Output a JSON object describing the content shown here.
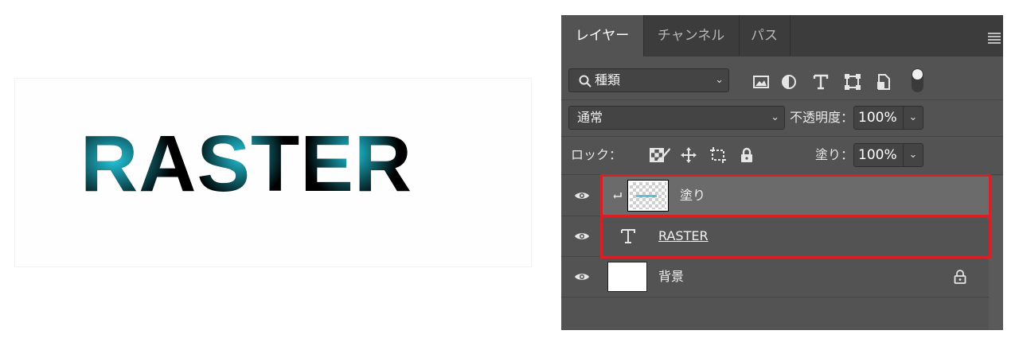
{
  "artwork": {
    "text": "RASTER",
    "glow_color": "#22c8dc"
  },
  "panel": {
    "tabs": [
      "レイヤー",
      "チャンネル",
      "パス"
    ],
    "filter": {
      "kind_label": "種類",
      "icons": [
        "image-filter-icon",
        "adjustment-filter-icon",
        "type-filter-icon",
        "shape-filter-icon",
        "smart-object-filter-icon",
        "filter-toggle-icon"
      ]
    },
    "blend_mode": "通常",
    "opacity_label": "不透明度：",
    "opacity_value": "100%",
    "lock_label": "ロック：",
    "lock_icons": [
      "lock-transparent-icon",
      "lock-paint-icon",
      "lock-position-icon",
      "lock-artboard-icon",
      "lock-all-icon"
    ],
    "fill_label": "塗り：",
    "fill_value": "100%",
    "layers": [
      {
        "name": "塗り",
        "type": "raster-clipped",
        "selected": true,
        "highlighted": true
      },
      {
        "name": "RASTER",
        "type": "text",
        "selected": false,
        "highlighted": true
      },
      {
        "name": "背景",
        "type": "background",
        "locked": true
      }
    ],
    "colors": {
      "panel_bg": "#535353",
      "tab_bg": "#3c3c3c",
      "selected_row": "#6b6b6b",
      "highlight": "#d81f26"
    }
  }
}
